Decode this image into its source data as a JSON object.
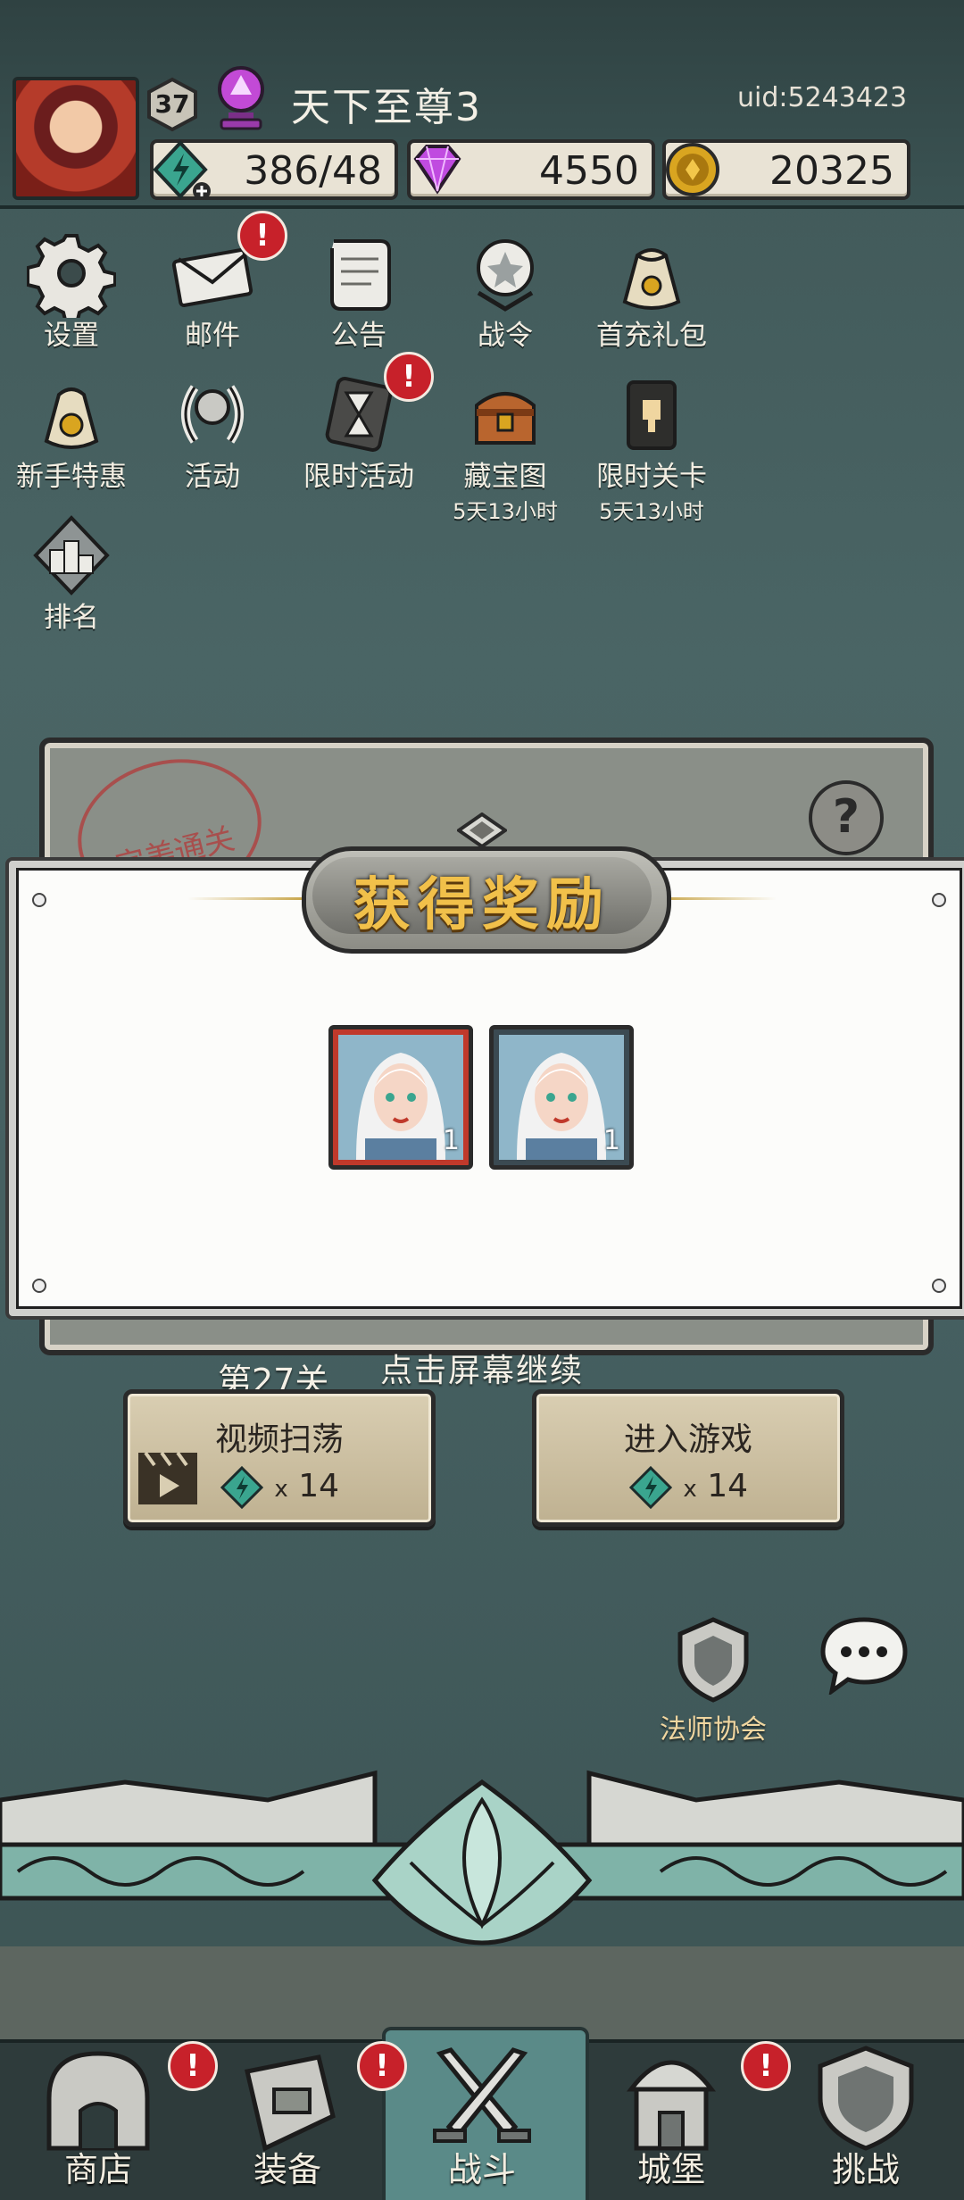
{
  "header": {
    "level": "37",
    "player_name": "天下至尊3",
    "uid": "uid:5243423",
    "energy": "386/48",
    "gems": "4550",
    "gold": "20325"
  },
  "menu": [
    {
      "label": "设置",
      "icon": "gear-icon"
    },
    {
      "label": "邮件",
      "icon": "mail-icon",
      "badge": "!"
    },
    {
      "label": "公告",
      "icon": "scroll-icon"
    },
    {
      "label": "战令",
      "icon": "battle-pass-icon"
    },
    {
      "label": "首充礼包",
      "icon": "gift-bag-icon"
    },
    {
      "label": "新手特惠",
      "icon": "money-bag-icon"
    },
    {
      "label": "活动",
      "icon": "laurel-icon"
    },
    {
      "label": "限时活动",
      "icon": "hourglass-icon",
      "badge": "!"
    },
    {
      "label": "藏宝图",
      "sub": "5天13小时",
      "icon": "treasure-chest-icon"
    },
    {
      "label": "限时关卡",
      "sub": "5天13小时",
      "icon": "tower-icon"
    },
    {
      "label": "排名",
      "icon": "podium-icon"
    }
  ],
  "stage": {
    "stamp": "完美通关",
    "label": "第27关",
    "sweep_label": "视频扫荡",
    "enter_label": "进入游戏",
    "cost_prefix": "x",
    "sweep_cost": "14",
    "enter_cost": "14"
  },
  "modal": {
    "title": "获得奖励",
    "rewards": [
      {
        "count": "1",
        "frame": "#c0392b"
      },
      {
        "count": "1",
        "frame": "#3b4a52"
      }
    ],
    "hint": "点击屏幕继续"
  },
  "side": {
    "mages_guild": "法师协会"
  },
  "nav": [
    {
      "label": "商店",
      "icon": "shop-icon",
      "badge": "!"
    },
    {
      "label": "装备",
      "icon": "equipment-icon",
      "badge": "!"
    },
    {
      "label": "战斗",
      "icon": "crossed-swords-icon",
      "active": true
    },
    {
      "label": "城堡",
      "icon": "castle-icon",
      "badge": "!"
    },
    {
      "label": "挑战",
      "icon": "shield-icon"
    }
  ],
  "colors": {
    "background": "#455f60",
    "badge": "#c7212a",
    "title_gold": "#f1c04a",
    "active_tab": "#5a8a88"
  }
}
